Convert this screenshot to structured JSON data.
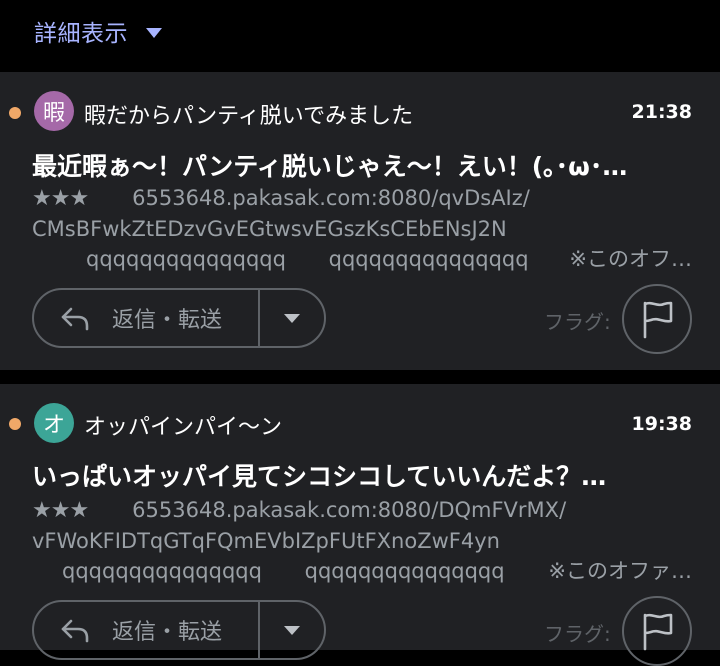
{
  "header": {
    "detail_label": "詳細表示"
  },
  "colors": {
    "accent": "#a8b4ff",
    "unread_dot": "#f0a868",
    "card_bg": "#202124",
    "muted_text": "#9aa0a6"
  },
  "messages": [
    {
      "avatar_letter": "暇",
      "avatar_color": "#a569a8",
      "sender": "暇だからパンティ脱いでみました",
      "time": "21:38",
      "subject": "最近暇ぁ〜！パンティ脱いじゃえ〜！えい！(｡･ω･…",
      "stars": "★★★",
      "snippet_url": "6553648.pakasak.com:8080/qvDsAIz/",
      "snippet_line2": "CMsBFwkZtEDzvGvEGtwsvEGszKsCEbENsJ2N",
      "snippet_q1": "qqqqqqqqqqqqqqq",
      "snippet_q2": "qqqqqqqqqqqqqqq",
      "snippet_offer": "※このオフ…",
      "reply_label": "返信・転送",
      "flag_label": "フラグ:"
    },
    {
      "avatar_letter": "オ",
      "avatar_color": "#3ca597",
      "sender": "オッパインパイ〜ン",
      "time": "19:38",
      "subject": "いっぱいオッパイ見てシコシコしていいんだよ？…",
      "stars": "★★★",
      "snippet_url": "6553648.pakasak.com:8080/DQmFVrMX/",
      "snippet_line2": "vFWoKFIDTqGTqFQmEVbIZpFUtFXnoZwF4yn",
      "snippet_q1": "qqqqqqqqqqqqqqq",
      "snippet_q2": "qqqqqqqqqqqqqqq",
      "snippet_offer": "※このオファ…",
      "reply_label": "返信・転送",
      "flag_label": "フラグ:"
    }
  ]
}
